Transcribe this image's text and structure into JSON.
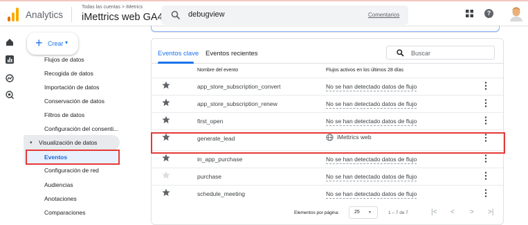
{
  "topbar": {
    "app_name": "Analytics",
    "account_breadcrumb": "Todas las cuentas > iMetrics",
    "property_name": "iMettrics web GA4",
    "search_value": "debugview",
    "search_link": "Comentarios",
    "help_label": "?"
  },
  "leftnav": {
    "create_label": "Crear",
    "items_before": [
      "Flujos de datos",
      "Recogida de datos",
      "Importación de datos",
      "Conservación de datos",
      "Filtros de datos",
      "Configuración del consenti..."
    ],
    "section_label": "Visualización de datos",
    "active_item": "Eventos",
    "items_after": [
      "Configuración de red",
      "Audiencias",
      "Anotaciones",
      "Comparaciones"
    ]
  },
  "tabs": [
    "Eventos clave",
    "Eventos recientes"
  ],
  "table_search_placeholder": "Buscar",
  "columns": [
    "Nombre del evento",
    "Flujos activos en los últimos 28 días"
  ],
  "rows": [
    {
      "event": "app_store_subscription_convert",
      "flow": "No se han detectado datos de flujo",
      "starred": true
    },
    {
      "event": "app_store_subscription_renew",
      "flow": "No se han detectado datos de flujo",
      "starred": true
    },
    {
      "event": "first_open",
      "flow": "No se han detectado datos de flujo",
      "starred": true
    },
    {
      "event": "generate_lead",
      "flow": "iMettrics web",
      "starred": true
    },
    {
      "event": "in_app_purchase",
      "flow": "No se han detectado datos de flujo",
      "starred": true
    },
    {
      "event": "purchase",
      "flow": "No se han detectado datos de flujo",
      "starred": false
    },
    {
      "event": "schedule_meeting",
      "flow": "No se han detectado datos de flujo",
      "starred": true
    }
  ],
  "pager": {
    "per_page_label": "Elementos por página:",
    "per_page_value": "25",
    "range": "1 – 7 de 7"
  },
  "colors": {
    "accent": "#1a73e8",
    "highlight_border": "#e53935",
    "star_filled": "#5f6368",
    "star_disabled": "#dadce0"
  }
}
